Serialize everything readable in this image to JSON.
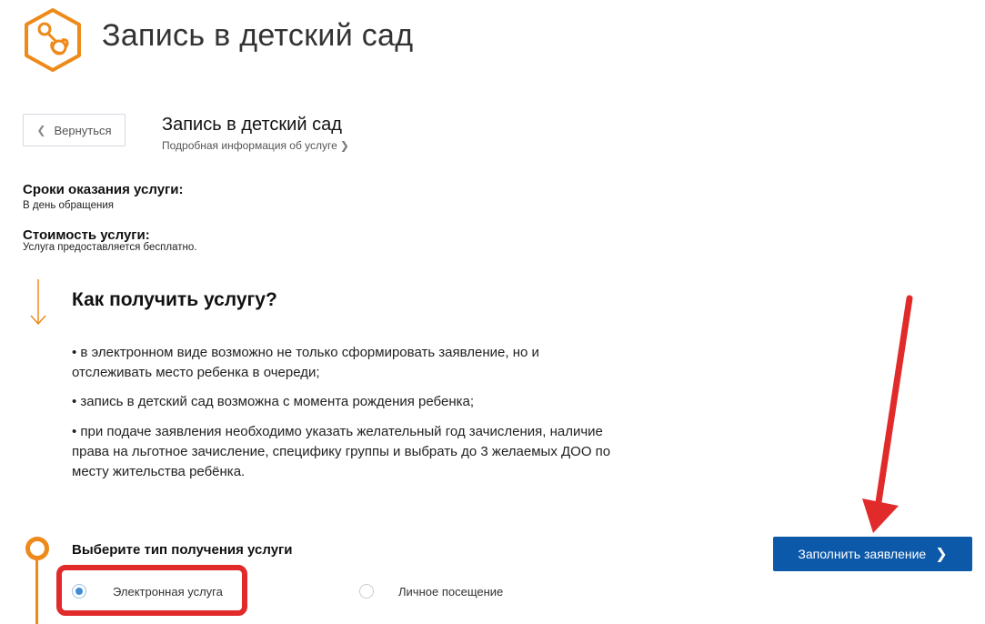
{
  "header": {
    "title": "Запись в детский сад",
    "logo_icon": "pacifier-icon",
    "logo_color": "#ee8a1a"
  },
  "nav": {
    "back_label": "Вернуться",
    "back_icon": "chevron-left-icon"
  },
  "service": {
    "title": "Запись в детский сад",
    "info_link": "Подробная информация об услуге",
    "info_icon": "chevron-right-icon"
  },
  "terms": {
    "heading": "Сроки оказания услуги:",
    "value": "В день обращения"
  },
  "cost": {
    "heading": "Стоимость услуги:",
    "value": "Услуга предоставляется бесплатно."
  },
  "how": {
    "heading": "Как получить услугу?",
    "bullets": [
      "• в электронном виде возможно не только сформировать заявление, но и отслеживать место ребенка в очереди;",
      "• запись в детский сад возможна с момента рождения ребенка;",
      "• при подаче заявления необходимо указать желательный год зачисления, наличие права на льготное зачисление, специфику группы и выбрать до 3 желаемых ДОО по месту жительства ребёнка."
    ]
  },
  "choose": {
    "heading": "Выберите тип получения услуги",
    "options": [
      {
        "label": "Электронная услуга",
        "selected": true
      },
      {
        "label": "Личное посещение",
        "selected": false
      }
    ]
  },
  "actions": {
    "submit_label": "Заполнить заявление",
    "submit_color": "#0d59a9"
  },
  "annotations": {
    "highlight_color": "#e12b2b",
    "arrow_color": "#e12b2b"
  }
}
